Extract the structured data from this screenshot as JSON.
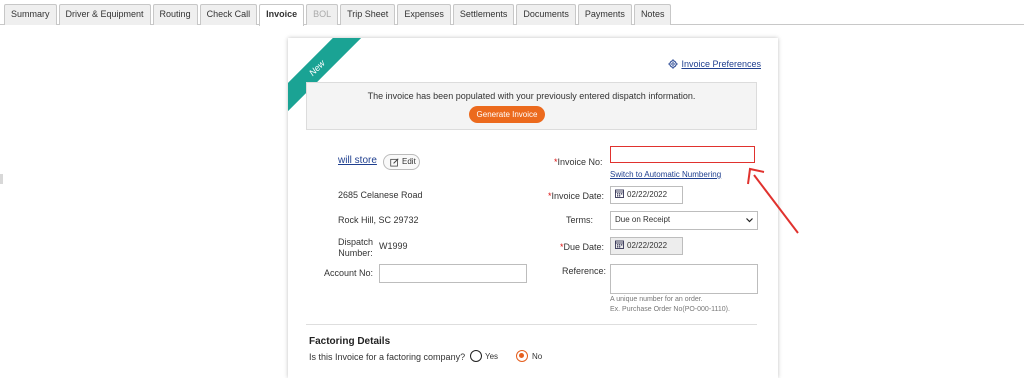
{
  "tabs": [
    {
      "label": "Summary"
    },
    {
      "label": "Driver & Equipment"
    },
    {
      "label": "Routing"
    },
    {
      "label": "Check Call"
    },
    {
      "label": "Invoice"
    },
    {
      "label": "BOL"
    },
    {
      "label": "Trip Sheet"
    },
    {
      "label": "Expenses"
    },
    {
      "label": "Settlements"
    },
    {
      "label": "Documents"
    },
    {
      "label": "Payments"
    },
    {
      "label": "Notes"
    }
  ],
  "active_tab": "Invoice",
  "ribbon": "New",
  "preferences_link": "Invoice Preferences",
  "banner": {
    "text": "The invoice has been populated with your previously entered dispatch information.",
    "button": "Generate Invoice"
  },
  "customer": {
    "name": "will store",
    "edit_label": "Edit",
    "address1": "2685 Celanese Road",
    "address2": "Rock Hill, SC 29732",
    "dispatch_label_1": "Dispatch",
    "dispatch_label_2": "Number:",
    "dispatch_number": "W1999",
    "account_label": "Account No:",
    "account_value": ""
  },
  "invoice": {
    "req_mark": "*",
    "number_label": "Invoice No:",
    "number_value": "",
    "switch_link": "Switch to Automatic Numbering",
    "date_label": "Invoice Date:",
    "date_value": "02/22/2022",
    "terms_label": "Terms:",
    "terms_value": "Due on Receipt",
    "due_label": "Due Date:",
    "due_value": "02/22/2022",
    "reference_label": "Reference:",
    "reference_hint_1": "A unique number for an order.",
    "reference_hint_2": "Ex. Purchase Order No(PO-000-1110)."
  },
  "factoring": {
    "title": "Factoring Details",
    "question": "Is this Invoice for a factoring company?",
    "yes": "Yes",
    "no": "No",
    "selected": "No"
  },
  "colors": {
    "accent_orange": "#ec6a1d",
    "ribbon_teal": "#1aa394",
    "link_blue": "#1f3f8f",
    "error_red": "#e0322e"
  }
}
